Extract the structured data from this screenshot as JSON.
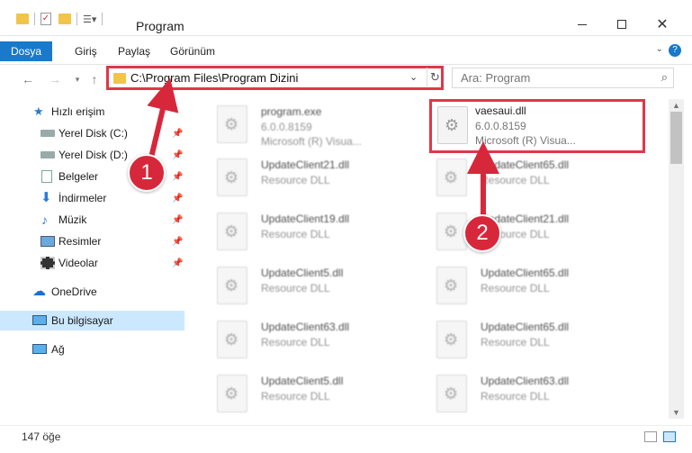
{
  "window": {
    "title": "Program"
  },
  "ribbon": {
    "tabs": [
      {
        "label": "Dosya"
      },
      {
        "label": "Giriş"
      },
      {
        "label": "Paylaş"
      },
      {
        "label": "Görünüm"
      }
    ]
  },
  "address": {
    "path": "C:\\Program Files\\Program Dizini"
  },
  "search": {
    "placeholder": "Ara: Program"
  },
  "sidebar": {
    "items": [
      {
        "label": "Hızlı erişim",
        "icon": "star-icon"
      },
      {
        "label": "Yerel Disk (C:)",
        "icon": "drive-icon"
      },
      {
        "label": "Yerel Disk (D:)",
        "icon": "drive-icon"
      },
      {
        "label": "Belgeler",
        "icon": "documents-icon"
      },
      {
        "label": "İndirmeler",
        "icon": "download-icon"
      },
      {
        "label": "Müzik",
        "icon": "music-icon"
      },
      {
        "label": "Resimler",
        "icon": "pictures-icon"
      },
      {
        "label": "Videolar",
        "icon": "video-icon"
      },
      {
        "label": "OneDrive",
        "icon": "cloud-icon"
      },
      {
        "label": "Bu bilgisayar",
        "icon": "computer-icon"
      },
      {
        "label": "Ağ",
        "icon": "network-icon"
      }
    ]
  },
  "files": [
    {
      "name": "program.exe",
      "line1": "6.0.0.8159",
      "line2": "Microsoft (R) Visua..."
    },
    {
      "name": "vaesaui.dll",
      "line1": "6.0.0.8159",
      "line2": "Microsoft (R) Visua..."
    },
    {
      "name": "UpdateClient21.dll",
      "line1": "Resource DLL"
    },
    {
      "name": "UpdateClient65.dll",
      "line1": "Resource DLL"
    },
    {
      "name": "UpdateClient19.dll",
      "line1": "Resource DLL"
    },
    {
      "name": "UpdateClient21.dll",
      "line1": "Resource DLL"
    },
    {
      "name": "UpdateClient5.dll",
      "line1": "Resource DLL"
    },
    {
      "name": "UpdateClient65.dll",
      "line1": "Resource DLL"
    },
    {
      "name": "UpdateClient63.dll",
      "line1": "Resource DLL"
    },
    {
      "name": "UpdateClient65.dll",
      "line1": "Resource DLL"
    },
    {
      "name": "UpdateClient5.dll",
      "line1": "Resource DLL"
    },
    {
      "name": "UpdateClient63.dll",
      "line1": "Resource DLL"
    }
  ],
  "status": {
    "count": "147 öğe"
  },
  "callouts": {
    "one": "1",
    "two": "2"
  },
  "colors": {
    "accent": "#1979ca",
    "highlight": "#e0364a",
    "callout": "#d7283b"
  }
}
